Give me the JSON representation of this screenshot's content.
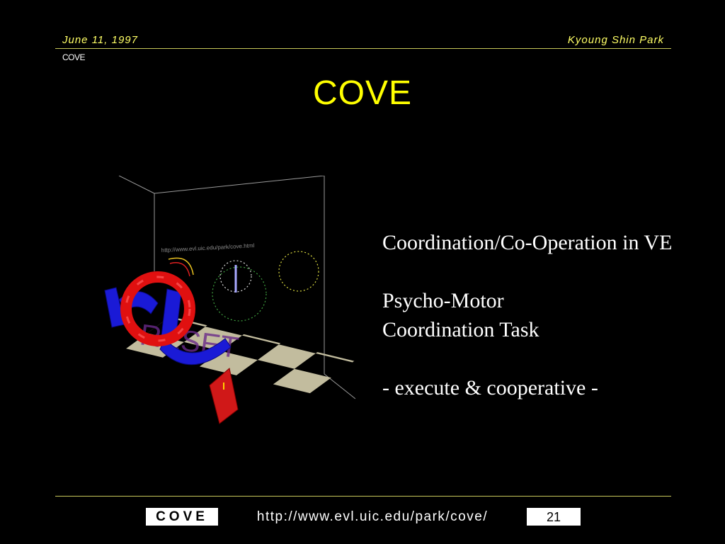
{
  "header": {
    "date": "June 11, 1997",
    "author": "Kyoung Shin Park",
    "section": "COVE"
  },
  "slide": {
    "title": "COVE",
    "bullets": [
      "Coordination/Co-Operation in VE",
      "",
      "Psycho-Motor",
      "Coordination Task",
      "",
      "- execute & cooperative -"
    ]
  },
  "scene": {
    "wall_url": "http://www.evl.uic.edu/park/cove.html",
    "wall_word": "RESET",
    "colors": {
      "floor_light": "#c2bc9e",
      "floor_dark": "#000000",
      "ring": "#e01010",
      "arm": "#1a1ad6",
      "block": "#d01818"
    }
  },
  "footer": {
    "name": "COVE",
    "url": "http://www.evl.uic.edu/park/cove/",
    "page": "21"
  },
  "colors": {
    "background": "#000000",
    "title": "#ffff00",
    "header_text": "#ffff66",
    "rule": "#c8c85a"
  }
}
